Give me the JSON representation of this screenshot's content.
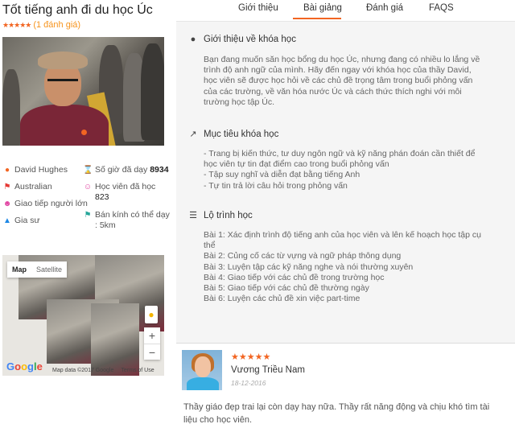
{
  "course": {
    "title": "Tốt tiếng anh đi du học Úc",
    "stars": "★★★★★",
    "rating_count": "(1 đánh giá)"
  },
  "tutor": {
    "name": "David Hughes",
    "nationality": "Australian",
    "specialty": "Giao tiếp người lớn",
    "role": "Gia sư",
    "hours_label": "Số giờ đã dạy",
    "hours_value": "8934",
    "students_label": "Học viên đã học",
    "students_value": "823",
    "radius_label": "Bán kính có thể dạy",
    "radius_value": ": 5km"
  },
  "map": {
    "type_map": "Map",
    "type_satellite": "Satellite",
    "zoom_in": "+",
    "zoom_out": "−",
    "attribution": "Map data ©2017 Google",
    "terms": "Terms of Use",
    "logo": "Google"
  },
  "tabs": [
    {
      "label": "Giới thiệu"
    },
    {
      "label": "Bài giảng"
    },
    {
      "label": "Đánh giá"
    },
    {
      "label": "FAQS"
    }
  ],
  "intro": {
    "heading": "Giới thiệu về khóa học",
    "lines": [
      "Bạn đang muốn săn học bổng du học Úc, nhưng đang có nhiều lo lắng về",
      "trình độ anh ngữ của mình. Hãy đến ngay với khóa học của thầy David,",
      "học viên sẽ được học hỏi về các chủ đề trọng tâm trong buổi phỏng vấn",
      "của các trường, về văn hóa nước Úc và cách thức thích nghi với môi",
      "trường học tập Úc."
    ]
  },
  "goals": {
    "heading": "Mục tiêu khóa học",
    "lines": [
      "- Trang bị kiến thức, tư duy ngôn ngữ và kỹ năng phán đoán cần thiết để",
      "học viên tự tin đạt điểm cao trong buổi phỏng vấn",
      "- Tập suy nghĩ và diễn đạt bằng tiếng Anh",
      "- Tự tin trả lời câu hỏi trong phỏng vấn"
    ]
  },
  "roadmap": {
    "heading": "Lộ trình học",
    "lines": [
      "Bài 1: Xác định trình độ tiếng anh của học viên và lên kế hoạch học tập cụ",
      "thể",
      "Bài 2: Củng cố các từ vựng và ngữ pháp thông dụng",
      "Bài 3: Luyện tập các kỹ năng nghe và nói thường xuyên",
      "Bài 4: Giao tiếp với các chủ đề trong trường học",
      "Bài 5: Giao tiếp với các chủ đề thường ngày",
      "Bài 6: Luyện các chủ đề xin việc part-time"
    ]
  },
  "review": {
    "stars": "★★★★★",
    "name": "Vương Triều Nam",
    "date": "18-12-2016",
    "text_line1": "Thầy giáo đẹp trai lại còn dạy hay nữa. Thầy rất năng động và chịu khó tìm tài",
    "text_line2": "liệu cho học viên."
  },
  "colors": {
    "accent": "#f26522",
    "star": "#f26522",
    "panel_bg": "#f5f5f5"
  }
}
